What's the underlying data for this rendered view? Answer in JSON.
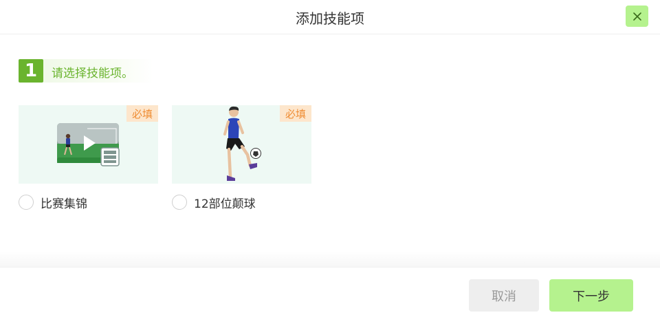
{
  "dialog": {
    "title": "添加技能项",
    "close_icon": "close-icon"
  },
  "step": {
    "number": "1",
    "label": "请选择技能项。"
  },
  "skills": [
    {
      "label": "比赛集锦",
      "badge": "必填",
      "icon": "video-play-thumbnail",
      "selected": false
    },
    {
      "label": "12部位颠球",
      "badge": "必填",
      "icon": "juggling-player-illustration",
      "selected": false
    }
  ],
  "footer": {
    "cancel_label": "取消",
    "next_label": "下一步"
  },
  "colors": {
    "accent_green": "#6ab42e",
    "button_green": "#b5f28e",
    "badge_bg": "#fde6cc",
    "badge_text": "#ef8d34",
    "thumb_bg": "#eef9f4"
  }
}
